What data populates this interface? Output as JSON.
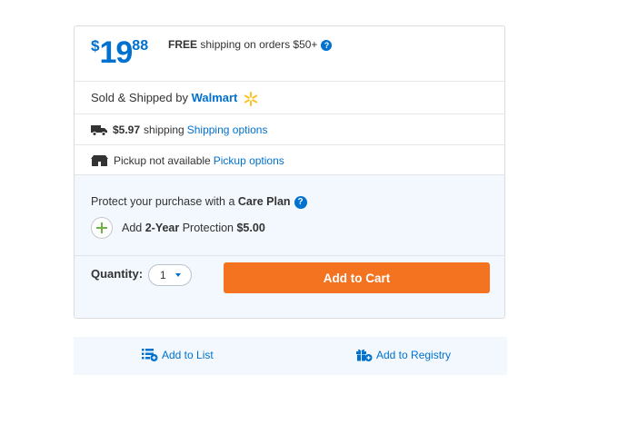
{
  "price": {
    "currency": "$",
    "dollars": "19",
    "cents": "88"
  },
  "free_shipping": {
    "bold": "FREE",
    "text": " shipping on orders $50+",
    "help_icon": "question-circle-icon"
  },
  "sold": {
    "prefix": "Sold & Shipped by ",
    "brand": "Walmart",
    "logo_icon": "walmart-spark-icon"
  },
  "shipping": {
    "icon": "truck-icon",
    "cost": "$5.97",
    "text": "shipping",
    "link": "Shipping options"
  },
  "pickup": {
    "icon": "store-icon",
    "text": "Pickup not available",
    "link": "Pickup options"
  },
  "care": {
    "title_prefix": "Protect your purchase with a ",
    "title_bold": "Care Plan",
    "add_prefix": "Add ",
    "add_bold": "2-Year",
    "add_mid": " Protection ",
    "add_price": "$5.00"
  },
  "quantity": {
    "label": "Quantity:",
    "value": "1"
  },
  "add_to_cart": "Add to Cart",
  "bottom_links": {
    "list": "Add to List",
    "registry": "Add to Registry"
  },
  "colors": {
    "blue": "#0071ce",
    "orange": "#f47321",
    "green": "#6cb33f",
    "yellow": "#ffc220"
  }
}
